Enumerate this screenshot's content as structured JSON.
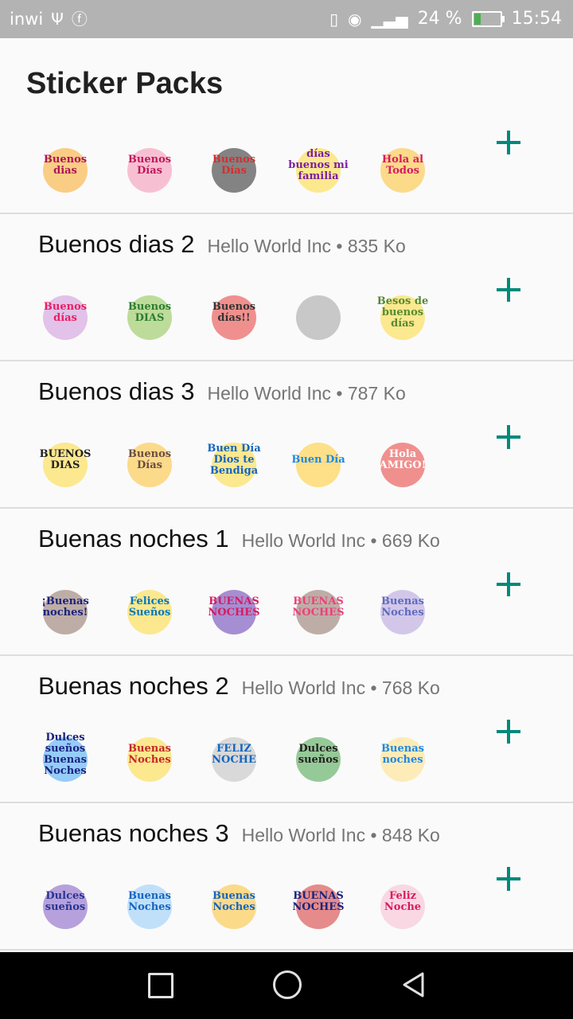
{
  "statusbar": {
    "carrier": "inwi",
    "battery_text": "24 %",
    "time": "15:54",
    "icons": [
      "usb-icon",
      "facebook-icon",
      "vibrate-icon",
      "eye-icon",
      "signal-icon",
      "battery-icon"
    ]
  },
  "header": {
    "title": "Sticker Packs"
  },
  "packs": [
    {
      "name": "",
      "meta": "",
      "stickers": [
        {
          "text": "Buenos dias",
          "color": "#ad1457",
          "accent": "#f9a825"
        },
        {
          "text": "Buenos Días",
          "color": "#c2185b",
          "accent": "#f48fb1"
        },
        {
          "text": "Buenos Días",
          "color": "#d32f2f",
          "accent": "#212121"
        },
        {
          "text": "días buenos mi familia",
          "color": "#7b1fa2",
          "accent": "#fdd835"
        },
        {
          "text": "Hola al Todos",
          "color": "#d81b60",
          "accent": "#fbc02d"
        }
      ]
    },
    {
      "name": "Buenos dias 2",
      "meta": "Hello World Inc • 835 Ko",
      "stickers": [
        {
          "text": "Buenos días",
          "color": "#e91e63",
          "accent": "#ce93d8"
        },
        {
          "text": "Buenos DIAS",
          "color": "#2e7d32",
          "accent": "#8bc34a"
        },
        {
          "text": "Buenos días!!",
          "color": "#333333",
          "accent": "#e53935"
        },
        {
          "text": "",
          "color": "#333333",
          "accent": "#9e9e9e"
        },
        {
          "text": "Besos de buenos días",
          "color": "#558b2f",
          "accent": "#fdd835"
        }
      ]
    },
    {
      "name": "Buenos dias 3",
      "meta": "Hello World Inc • 787 Ko",
      "stickers": [
        {
          "text": "BUENOS DIAS",
          "color": "#212121",
          "accent": "#fdd835"
        },
        {
          "text": "Buenos Días",
          "color": "#6d4c41",
          "accent": "#fbc02d"
        },
        {
          "text": "Buen Día Dios te Bendiga",
          "color": "#1565c0",
          "accent": "#fdd835"
        },
        {
          "text": "Buen Día",
          "color": "#1e88e5",
          "accent": "#ffca28"
        },
        {
          "text": "Hola AMIGO!",
          "color": "#ffffff",
          "accent": "#e53935"
        }
      ]
    },
    {
      "name": "Buenas noches 1",
      "meta": "Hello World Inc • 669 Ko",
      "stickers": [
        {
          "text": "¡Buenas noches!",
          "color": "#1a237e",
          "accent": "#8d6e63"
        },
        {
          "text": "Felices Sueños",
          "color": "#0277bd",
          "accent": "#fdd835"
        },
        {
          "text": "BUENAS NOCHES",
          "color": "#d81b60",
          "accent": "#5e35b1"
        },
        {
          "text": "BUENAS NOCHES",
          "color": "#ec407a",
          "accent": "#8d6e63"
        },
        {
          "text": "Buenas Noches",
          "color": "#5c6bc0",
          "accent": "#b39ddb"
        }
      ]
    },
    {
      "name": "Buenas noches 2",
      "meta": "Hello World Inc • 768 Ko",
      "stickers": [
        {
          "text": "Dulces sueños Buenas Noches",
          "color": "#1a237e",
          "accent": "#42a5f5"
        },
        {
          "text": "Buenas Noches",
          "color": "#c62828",
          "accent": "#fdd835"
        },
        {
          "text": "FELIZ NOCHE",
          "color": "#1565c0",
          "accent": "#bdbdbd"
        },
        {
          "text": "Dulces sueños",
          "color": "#212121",
          "accent": "#43a047"
        },
        {
          "text": "Buenas noches",
          "color": "#1e88e5",
          "accent": "#ffe082"
        }
      ]
    },
    {
      "name": "Buenas noches 3",
      "meta": "Hello World Inc • 848 Ko",
      "stickers": [
        {
          "text": "Dulces sueños",
          "color": "#283593",
          "accent": "#7e57c2"
        },
        {
          "text": "Buenas Noches",
          "color": "#1565c0",
          "accent": "#90caf9"
        },
        {
          "text": "Buenas Noches",
          "color": "#1565c0",
          "accent": "#fbc02d"
        },
        {
          "text": "BUENAS NOCHES",
          "color": "#1a237e",
          "accent": "#d32f2f"
        },
        {
          "text": "Feliz Noche",
          "color": "#d81b60",
          "accent": "#f8bbd0"
        }
      ]
    }
  ]
}
